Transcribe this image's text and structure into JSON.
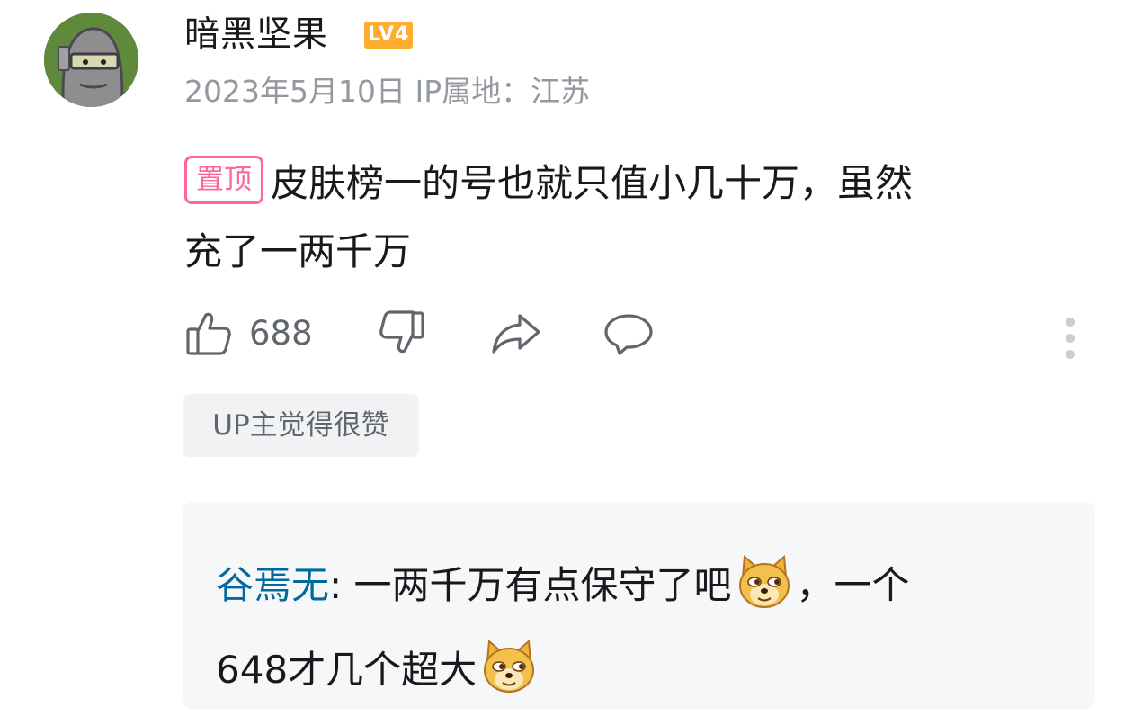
{
  "comment": {
    "username": "暗黑坚果",
    "level": "LV4",
    "meta": "2023年5月10日 IP属地：江苏",
    "pin_label": "置顶",
    "text_line1": "皮肤榜一的号也就只值小几十万，虽然",
    "text_line2": "充了一两千万",
    "like_count": "688",
    "up_tag": "UP主觉得很赞"
  },
  "reply": {
    "username": "谷焉无",
    "separator": ": ",
    "text_part1": "一两千万有点保守了吧",
    "text_part2": "，一个",
    "text_part3": "648才几个超大"
  },
  "icons": {
    "like": "thumbs-up-icon",
    "dislike": "thumbs-down-icon",
    "share": "share-arrow-icon",
    "reply": "speech-bubble-icon",
    "more": "vertical-dots-icon",
    "emoji": "doge-face-icon"
  },
  "colors": {
    "accent_pink": "#ff6699",
    "level_orange": "#ffad2f",
    "link_blue": "#00699d",
    "meta_gray": "#9499a0"
  }
}
